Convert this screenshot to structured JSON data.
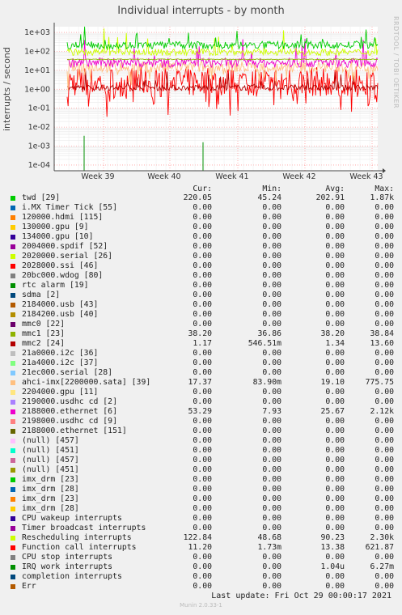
{
  "title": "Individual interrupts - by month",
  "side_label": "RRDTOOL / TOBI OETIKER",
  "footer": {
    "last_update": "Last update:  Fri Oct 29 00:00:17 2021",
    "munin": "Munin 2.0.33-1"
  },
  "legend_header": {
    "cur": "Cur:",
    "min": "Min:",
    "avg": "Avg:",
    "max": "Max:"
  },
  "chart_data": {
    "type": "line",
    "title": "Individual interrupts - by month",
    "ylabel": "interrupts / second",
    "yscale": "log",
    "ylim": [
      5e-05,
      2000
    ],
    "y_ticks": [
      "1e+03",
      "1e+02",
      "1e+01",
      "1e+00",
      "1e-01",
      "1e-02",
      "1e-03",
      "1e-04"
    ],
    "x_ticks": [
      "Week 39",
      "Week 40",
      "Week 41",
      "Week 42",
      "Week 43"
    ],
    "grid": true,
    "series": [
      {
        "name": "twd [29]",
        "color": "#00cc00",
        "cur": "220.05",
        "min": "45.24",
        "avg": "202.91",
        "max": "1.87k"
      },
      {
        "name": "i.MX Timer Tick [55]",
        "color": "#0066b3",
        "cur": "0.00",
        "min": "0.00",
        "avg": "0.00",
        "max": "0.00"
      },
      {
        "name": "120000.hdmi [115]",
        "color": "#ff8000",
        "cur": "0.00",
        "min": "0.00",
        "avg": "0.00",
        "max": "0.00"
      },
      {
        "name": "130000.gpu [9]",
        "color": "#ffcc00",
        "cur": "0.00",
        "min": "0.00",
        "avg": "0.00",
        "max": "0.00"
      },
      {
        "name": "134000.gpu [10]",
        "color": "#330099",
        "cur": "0.00",
        "min": "0.00",
        "avg": "0.00",
        "max": "0.00"
      },
      {
        "name": "2004000.spdif [52]",
        "color": "#990099",
        "cur": "0.00",
        "min": "0.00",
        "avg": "0.00",
        "max": "0.00"
      },
      {
        "name": "2020000.serial [26]",
        "color": "#ccff00",
        "cur": "0.00",
        "min": "0.00",
        "avg": "0.00",
        "max": "0.00"
      },
      {
        "name": "2028000.ssi [46]",
        "color": "#ff0000",
        "cur": "0.00",
        "min": "0.00",
        "avg": "0.00",
        "max": "0.00"
      },
      {
        "name": "20bc000.wdog [80]",
        "color": "#808080",
        "cur": "0.00",
        "min": "0.00",
        "avg": "0.00",
        "max": "0.00"
      },
      {
        "name": "rtc alarm [19]",
        "color": "#008f00",
        "cur": "0.00",
        "min": "0.00",
        "avg": "0.00",
        "max": "0.00"
      },
      {
        "name": "sdma [2]",
        "color": "#00487d",
        "cur": "0.00",
        "min": "0.00",
        "avg": "0.00",
        "max": "0.00"
      },
      {
        "name": "2184000.usb [43]",
        "color": "#b35a00",
        "cur": "0.00",
        "min": "0.00",
        "avg": "0.00",
        "max": "0.00"
      },
      {
        "name": "2184200.usb [40]",
        "color": "#b38f00",
        "cur": "0.00",
        "min": "0.00",
        "avg": "0.00",
        "max": "0.00"
      },
      {
        "name": "mmc0 [22]",
        "color": "#6b006b",
        "cur": "0.00",
        "min": "0.00",
        "avg": "0.00",
        "max": "0.00"
      },
      {
        "name": "mmc1 [23]",
        "color": "#8fb300",
        "cur": "38.20",
        "min": "36.86",
        "avg": "38.20",
        "max": "38.84"
      },
      {
        "name": "mmc2 [24]",
        "color": "#b30000",
        "cur": "1.17",
        "min": "546.51m",
        "avg": "1.34",
        "max": "13.60"
      },
      {
        "name": "21a0000.i2c [36]",
        "color": "#bebebe",
        "cur": "0.00",
        "min": "0.00",
        "avg": "0.00",
        "max": "0.00"
      },
      {
        "name": "21a4000.i2c [37]",
        "color": "#80ff80",
        "cur": "0.00",
        "min": "0.00",
        "avg": "0.00",
        "max": "0.00"
      },
      {
        "name": "21ec000.serial [28]",
        "color": "#80c9ff",
        "cur": "0.00",
        "min": "0.00",
        "avg": "0.00",
        "max": "0.00"
      },
      {
        "name": "ahci-imx[2200000.sata] [39]",
        "color": "#ffc080",
        "cur": "17.37",
        "min": "83.90m",
        "avg": "19.10",
        "max": "775.75"
      },
      {
        "name": "2204000.gpu [11]",
        "color": "#ffe680",
        "cur": "0.00",
        "min": "0.00",
        "avg": "0.00",
        "max": "0.00"
      },
      {
        "name": "2190000.usdhc cd [2]",
        "color": "#aa80ff",
        "cur": "0.00",
        "min": "0.00",
        "avg": "0.00",
        "max": "0.00"
      },
      {
        "name": "2188000.ethernet [6]",
        "color": "#ee00cc",
        "cur": "53.29",
        "min": "7.93",
        "avg": "25.67",
        "max": "2.12k"
      },
      {
        "name": "2198000.usdhc cd [9]",
        "color": "#ff8080",
        "cur": "0.00",
        "min": "0.00",
        "avg": "0.00",
        "max": "0.00"
      },
      {
        "name": "2188000.ethernet [151]",
        "color": "#666600",
        "cur": "0.00",
        "min": "0.00",
        "avg": "0.00",
        "max": "0.00"
      },
      {
        "name": "(null) [457]",
        "color": "#ffbfff",
        "cur": "0.00",
        "min": "0.00",
        "avg": "0.00",
        "max": "0.00"
      },
      {
        "name": "(null) [451]",
        "color": "#00ffcc",
        "cur": "0.00",
        "min": "0.00",
        "avg": "0.00",
        "max": "0.00"
      },
      {
        "name": "(null) [457]",
        "color": "#cc6699",
        "cur": "0.00",
        "min": "0.00",
        "avg": "0.00",
        "max": "0.00"
      },
      {
        "name": "(null) [451]",
        "color": "#999900",
        "cur": "0.00",
        "min": "0.00",
        "avg": "0.00",
        "max": "0.00"
      },
      {
        "name": "imx_drm [23]",
        "color": "#00cc00",
        "cur": "0.00",
        "min": "0.00",
        "avg": "0.00",
        "max": "0.00"
      },
      {
        "name": "imx_drm [28]",
        "color": "#0066b3",
        "cur": "0.00",
        "min": "0.00",
        "avg": "0.00",
        "max": "0.00"
      },
      {
        "name": "imx_drm [23]",
        "color": "#ff8000",
        "cur": "0.00",
        "min": "0.00",
        "avg": "0.00",
        "max": "0.00"
      },
      {
        "name": "imx_drm [28]",
        "color": "#ffcc00",
        "cur": "0.00",
        "min": "0.00",
        "avg": "0.00",
        "max": "0.00"
      },
      {
        "name": "CPU wakeup interrupts",
        "color": "#330099",
        "cur": "0.00",
        "min": "0.00",
        "avg": "0.00",
        "max": "0.00"
      },
      {
        "name": "Timer broadcast interrupts",
        "color": "#990099",
        "cur": "0.00",
        "min": "0.00",
        "avg": "0.00",
        "max": "0.00"
      },
      {
        "name": "Rescheduling interrupts",
        "color": "#ccff00",
        "cur": "122.84",
        "min": "48.68",
        "avg": "90.23",
        "max": "2.30k"
      },
      {
        "name": "Function call interrupts",
        "color": "#ff0000",
        "cur": "11.20",
        "min": "1.73m",
        "avg": "13.38",
        "max": "621.87"
      },
      {
        "name": "CPU stop interrupts",
        "color": "#808080",
        "cur": "0.00",
        "min": "0.00",
        "avg": "0.00",
        "max": "0.00"
      },
      {
        "name": "IRQ work interrupts",
        "color": "#008f00",
        "cur": "0.00",
        "min": "0.00",
        "avg": "1.04u",
        "max": "6.27m"
      },
      {
        "name": "completion interrupts",
        "color": "#00487d",
        "cur": "0.00",
        "min": "0.00",
        "avg": "0.00",
        "max": "0.00"
      },
      {
        "name": "Err",
        "color": "#b35a00",
        "cur": "0.00",
        "min": "0.00",
        "avg": "0.00",
        "max": "0.00"
      }
    ]
  }
}
